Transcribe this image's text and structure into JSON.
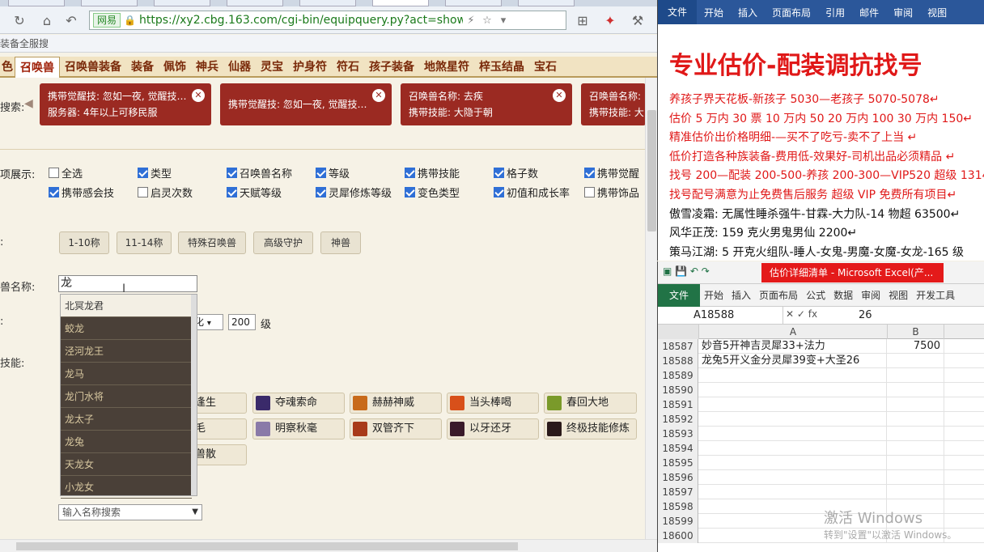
{
  "browser": {
    "url": "https://xy2.cbg.163.com/cgi-bin/equipquery.py?act=show_ov",
    "cert_label": "网易",
    "bookmark": "装备全服搜"
  },
  "categories": [
    "召唤兽",
    "召唤兽装备",
    "装备",
    "佩饰",
    "神兵",
    "仙器",
    "灵宝",
    "护身符",
    "符石",
    "孩子装备",
    "地煞星符",
    "梓玉结晶",
    "宝石"
  ],
  "search": {
    "label": "搜索:",
    "chips": [
      {
        "line1": "携带觉醒技: 忽如一夜, 觉醒技…",
        "line2": "服务器: 4年以上可移民服"
      },
      {
        "line1": "携带觉醒技: 忽如一夜, 觉醒技…",
        "line2": ""
      },
      {
        "line1": "召唤兽名称: 去疾",
        "line2": "携带技能: 大隐于朝"
      },
      {
        "line1": "召唤兽名称:",
        "line2": "携带技能: 大"
      }
    ]
  },
  "options": {
    "label": "项展示:",
    "items": [
      {
        "label": "全选",
        "checked": false
      },
      {
        "label": "类型",
        "checked": true
      },
      {
        "label": "召唤兽名称",
        "checked": true
      },
      {
        "label": "等级",
        "checked": true
      },
      {
        "label": "携带技能",
        "checked": true
      },
      {
        "label": "格子数",
        "checked": true
      },
      {
        "label": "携带觉醒",
        "checked": true
      },
      {
        "label": "携带感会技",
        "checked": true
      },
      {
        "label": "启灵次数",
        "checked": false
      },
      {
        "label": "天赋等级",
        "checked": true
      },
      {
        "label": "灵犀修炼等级",
        "checked": true
      },
      {
        "label": "变色类型",
        "checked": true
      },
      {
        "label": "初值和成长率",
        "checked": true
      },
      {
        "label": "携带饰品",
        "checked": false
      }
    ]
  },
  "quick": {
    "label": ":",
    "buttons": [
      "1-10称",
      "11-14称",
      "特殊召唤兽",
      "高级守护",
      "神兽"
    ]
  },
  "name_field": {
    "label": "兽名称:",
    "value": "龙"
  },
  "suggestions": [
    "北冥龙君",
    "蛟龙",
    "泾河龙王",
    "龙马",
    "龙门水将",
    "龙太子",
    "龙兔",
    "天龙女",
    "小龙女"
  ],
  "level": {
    "label": ":",
    "select_value": "化",
    "value": "200",
    "unit": "级"
  },
  "skills_label": "技能:",
  "skills": {
    "row1": [
      "逢生",
      "夺魂索命",
      "赫赫神威",
      "当头棒喝",
      "春回大地"
    ],
    "row2": [
      "毛",
      "明察秋毫",
      "双管齐下",
      "以牙还牙",
      "终极技能修炼"
    ],
    "row3": [
      "兽散"
    ]
  },
  "name_search_placeholder": "输入名称搜索",
  "word": {
    "tabs": [
      "文件",
      "开始",
      "插入",
      "页面布局",
      "引用",
      "邮件",
      "审阅",
      "视图"
    ],
    "title": "专业估价-配装调抗找号",
    "lines": [
      {
        "text": "养孩子界天花板-新孩子 5030—老孩子 5070-5078↵",
        "color": "red"
      },
      {
        "text": "估价 5 万内 30 票  10 万内 50  20 万内 100  30 万内 150↵",
        "color": "red"
      },
      {
        "text": "精准估价出价格明细-—买不了吃亏-卖不了上当 ↵",
        "color": "red"
      },
      {
        "text": "低价打造各种族装备-费用低-效果好-司机出品必须精品 ↵",
        "color": "red"
      },
      {
        "text": "找号 200—配装 200-500-养孩 200-300—VIP520 超级 1314↵",
        "color": "red"
      },
      {
        "text": "找号配号满意为止免费售后服务  超级 VIP 免费所有项目↵",
        "color": "red"
      },
      {
        "text": "傲雪凌霜: 无属性睡杀强牛-甘霖-大力队-14 物超 63500↵",
        "color": "black"
      },
      {
        "text": "风华正茂: 159 克火男鬼男仙 2200↵",
        "color": "black"
      },
      {
        "text": "策马江湖: 5 开克火组队-睡人-女鬼-男魔-女魔-女龙-165 级",
        "color": "black"
      }
    ]
  },
  "excel": {
    "title": "估价详细清单 - Microsoft Excel(产...",
    "tabs": [
      "文件",
      "开始",
      "插入",
      "页面布局",
      "公式",
      "数据",
      "审阅",
      "视图",
      "开发工具"
    ],
    "namebox": "A18588",
    "formula": "26",
    "columns": [
      "A",
      "B"
    ],
    "rows": [
      {
        "n": "18587",
        "a": "妙音5开神吉灵犀33+法力",
        "b": "7500"
      },
      {
        "n": "18588",
        "a": "龙兔5开义金分灵犀39变+大圣26",
        "b": ""
      },
      {
        "n": "18589",
        "a": "",
        "b": ""
      },
      {
        "n": "18590",
        "a": "",
        "b": ""
      },
      {
        "n": "18591",
        "a": "",
        "b": ""
      },
      {
        "n": "18592",
        "a": "",
        "b": ""
      },
      {
        "n": "18593",
        "a": "",
        "b": ""
      },
      {
        "n": "18594",
        "a": "",
        "b": ""
      },
      {
        "n": "18595",
        "a": "",
        "b": ""
      },
      {
        "n": "18596",
        "a": "",
        "b": ""
      },
      {
        "n": "18597",
        "a": "",
        "b": ""
      },
      {
        "n": "18598",
        "a": "",
        "b": ""
      },
      {
        "n": "18599",
        "a": "",
        "b": ""
      },
      {
        "n": "18600",
        "a": "",
        "b": ""
      }
    ]
  },
  "activation": {
    "title": "激活 Windows",
    "sub": "转到\"设置\"以激活 Windows。"
  }
}
